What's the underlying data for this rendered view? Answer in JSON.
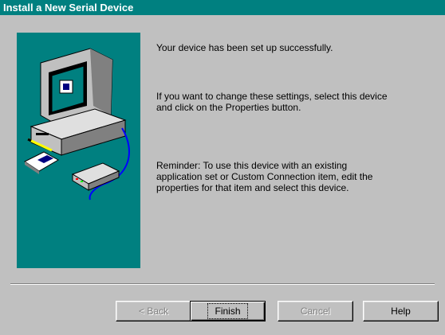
{
  "window": {
    "title": "Install a New Serial Device"
  },
  "content": {
    "line1": "Your device has been set up successfully.",
    "line2a": "If you want to change these settings, select this device",
    "line2b": "and click on the Properties button.",
    "line3a": "Reminder: To use this device with an existing",
    "line3b": "application set or Custom Connection item, edit the",
    "line3c": "properties for that item and select this device."
  },
  "buttons": {
    "back": "< Back",
    "finish": "Finish",
    "cancel": "Cancel",
    "help": "Help"
  },
  "colors": {
    "title_bar": "#008080",
    "illustration_bg": "#008080",
    "dialog_bg": "#c0c0c0"
  }
}
